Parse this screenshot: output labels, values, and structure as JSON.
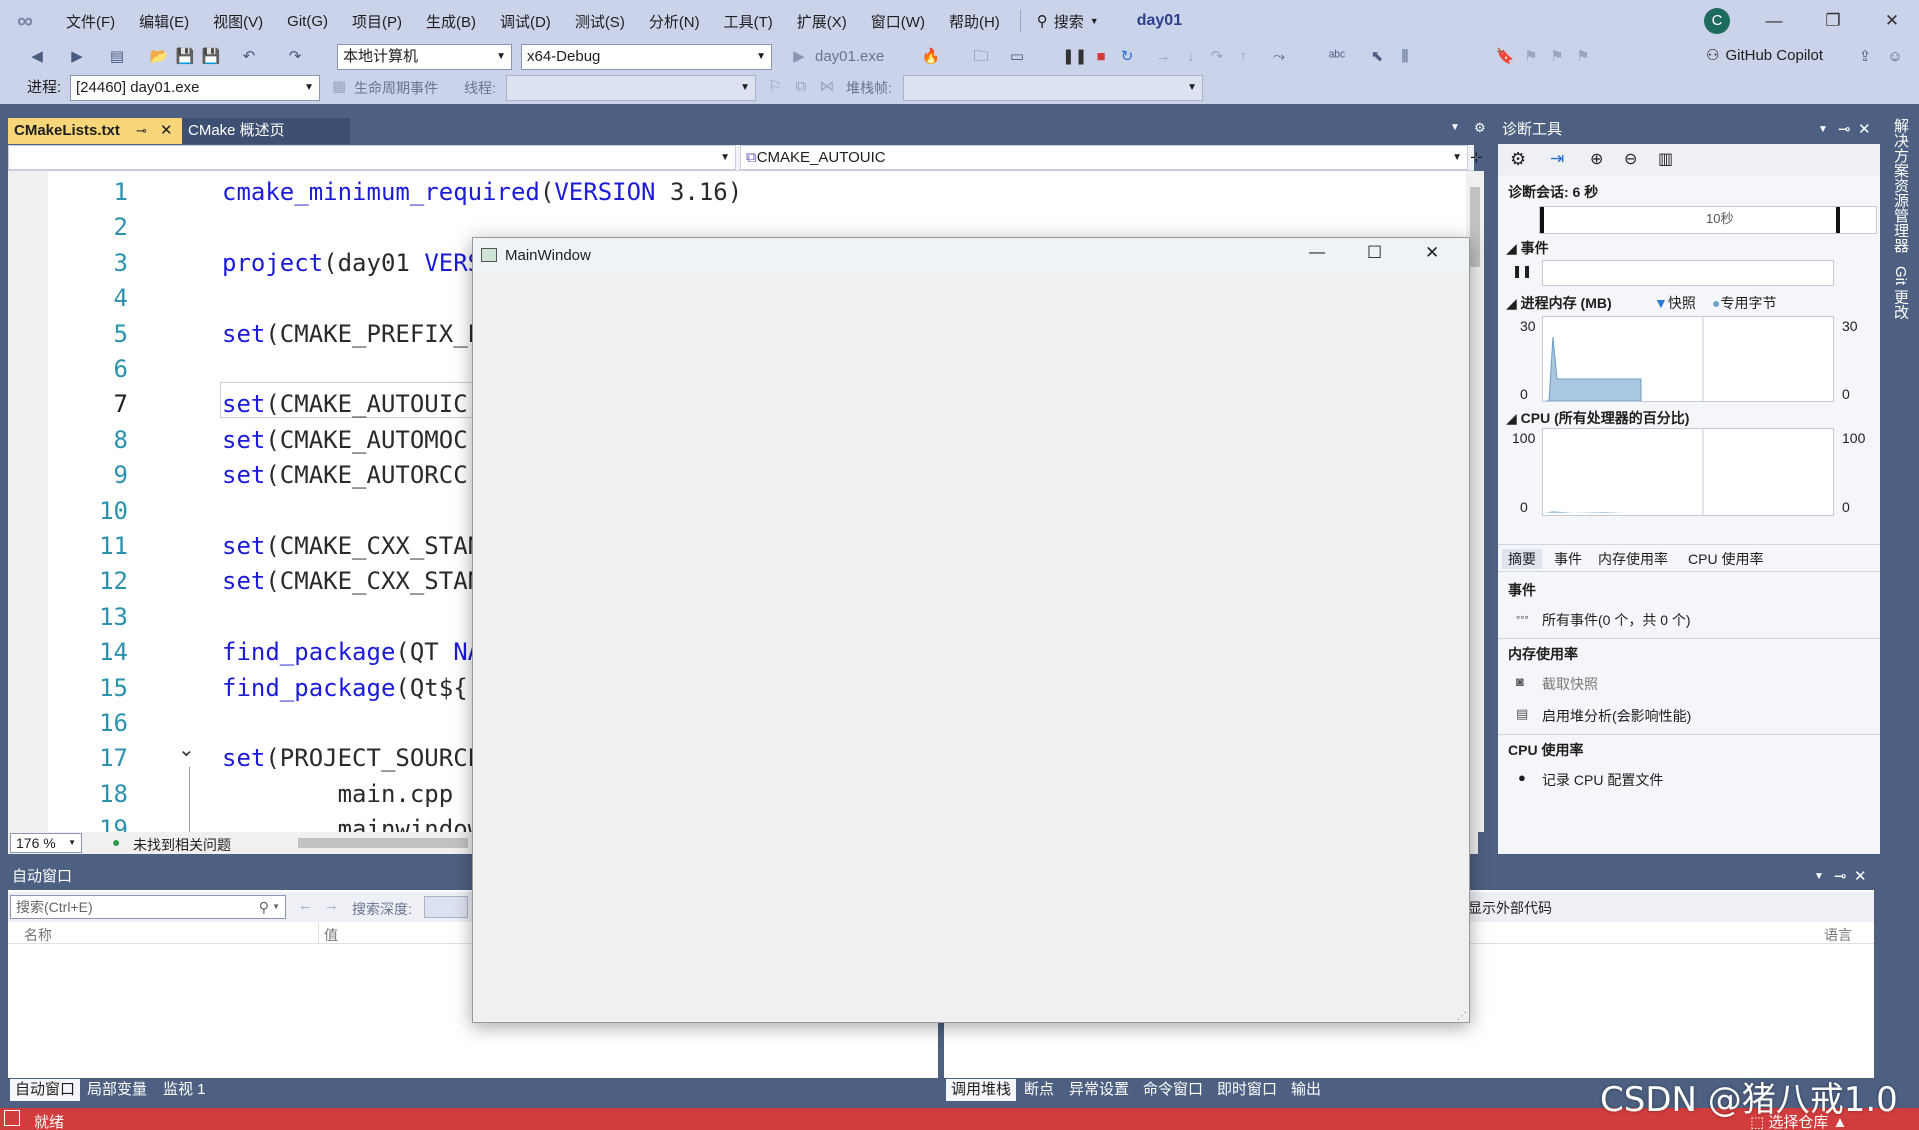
{
  "menubar": {
    "items": [
      "文件(F)",
      "编辑(E)",
      "视图(V)",
      "Git(G)",
      "项目(P)",
      "生成(B)",
      "调试(D)",
      "测试(S)",
      "分析(N)",
      "工具(T)",
      "扩展(X)",
      "窗口(W)",
      "帮助(H)"
    ],
    "search_label": "搜索",
    "solution_title": "day01",
    "avatar_letter": "C"
  },
  "toolbar1": {
    "target_machine": "本地计算机",
    "config": "x64-Debug",
    "startup_item": "day01.exe",
    "copilot": "GitHub Copilot"
  },
  "toolbar2": {
    "process_label": "进程:",
    "process_value": "[24460] day01.exe",
    "lifecycle_label": "生命周期事件",
    "thread_label": "线程:",
    "stackframe_label": "堆栈帧:"
  },
  "editor": {
    "tabs": [
      {
        "label": "CMakeLists.txt"
      },
      {
        "label": "CMake 概述页"
      }
    ],
    "nav_right": "CMAKE_AUTOUIC",
    "lines": [
      {
        "n": "1",
        "kw": "cmake_minimum_required",
        "rest": "(",
        "kw2": "VERSION",
        "rest2": " 3.16)"
      },
      {
        "n": "2",
        "kw": "",
        "rest": "",
        "kw2": "",
        "rest2": ""
      },
      {
        "n": "3",
        "kw": "project",
        "rest": "(day01 ",
        "kw2": "VERS",
        "rest2": ""
      },
      {
        "n": "4",
        "kw": "",
        "rest": "",
        "kw2": "",
        "rest2": ""
      },
      {
        "n": "5",
        "kw": "set",
        "rest": "(CMAKE_PREFIX_P",
        "kw2": "",
        "rest2": ""
      },
      {
        "n": "6",
        "kw": "",
        "rest": "",
        "kw2": "",
        "rest2": ""
      },
      {
        "n": "7",
        "kw": "set",
        "rest": "(CMAKE_AUTOUIC",
        "kw2": "",
        "rest2": ""
      },
      {
        "n": "8",
        "kw": "set",
        "rest": "(CMAKE_AUTOMOC",
        "kw2": "",
        "rest2": ""
      },
      {
        "n": "9",
        "kw": "set",
        "rest": "(CMAKE_AUTORCC",
        "kw2": "",
        "rest2": ""
      },
      {
        "n": "10",
        "kw": "",
        "rest": "",
        "kw2": "",
        "rest2": ""
      },
      {
        "n": "11",
        "kw": "set",
        "rest": "(CMAKE_CXX_STAN",
        "kw2": "",
        "rest2": ""
      },
      {
        "n": "12",
        "kw": "set",
        "rest": "(CMAKE_CXX_STAN",
        "kw2": "",
        "rest2": ""
      },
      {
        "n": "13",
        "kw": "",
        "rest": "",
        "kw2": "",
        "rest2": ""
      },
      {
        "n": "14",
        "kw": "find_package",
        "rest": "(QT ",
        "kw2": "NA",
        "rest2": ""
      },
      {
        "n": "15",
        "kw": "find_package",
        "rest": "(Qt${",
        "kw2": "",
        "rest2": ""
      },
      {
        "n": "16",
        "kw": "",
        "rest": "",
        "kw2": "",
        "rest2": ""
      },
      {
        "n": "17",
        "kw": "set",
        "rest": "(PROJECT_SOURCE",
        "kw2": "",
        "rest2": ""
      },
      {
        "n": "18",
        "kw": "",
        "rest": "        main.cpp",
        "kw2": "",
        "rest2": ""
      },
      {
        "n": "19",
        "kw": "",
        "rest": "        mainwindow",
        "kw2": "",
        "rest2": ""
      }
    ],
    "zoom": "176 %",
    "status": "未找到相关问题"
  },
  "diag": {
    "title": "诊断工具",
    "session": "诊断会话: 6 秒",
    "ruler_label": "10秒",
    "events_label": "事件",
    "memory_label": "进程内存 (MB)",
    "snapshot_legend": "快照",
    "private_legend": "专用字节",
    "mem_max": "30",
    "mem_min": "0",
    "cpu_label": "CPU (所有处理器的百分比)",
    "cpu_max": "100",
    "cpu_min": "0",
    "tabs": [
      "摘要",
      "事件",
      "内存使用率",
      "CPU 使用率"
    ],
    "summary_events": "事件",
    "all_events": "所有事件(0 个，共 0 个)",
    "memory_usage": "内存使用率",
    "take_snapshot": "截取快照",
    "heap_analysis": "启用堆分析(会影响性能)",
    "cpu_usage": "CPU 使用率",
    "record_cpu": "记录 CPU 配置文件"
  },
  "right_rail": [
    "解决方案资源管理器",
    "Git 更改"
  ],
  "autos": {
    "title": "自动窗口",
    "search_placeholder": "搜索(Ctrl+E)",
    "search_depth": "搜索深度:",
    "col_name": "名称",
    "col_value": "值",
    "tabs": [
      "自动窗口",
      "局部变量",
      "监视 1"
    ]
  },
  "callstack": {
    "show_external": "显示外部代码",
    "col_lang": "语言",
    "tabs": [
      "调用堆栈",
      "断点",
      "异常设置",
      "命令窗口",
      "即时窗口",
      "输出"
    ]
  },
  "status": {
    "ready": "就绪",
    "repo": "选择仓库"
  },
  "mainwindow": {
    "title": "MainWindow"
  },
  "watermark": "CSDN @猪八戒1.0",
  "colors": {
    "accent": "#f7d67a",
    "chrome": "#4d6082",
    "status": "#d13c3c",
    "keyword": "#1b1bd8"
  }
}
